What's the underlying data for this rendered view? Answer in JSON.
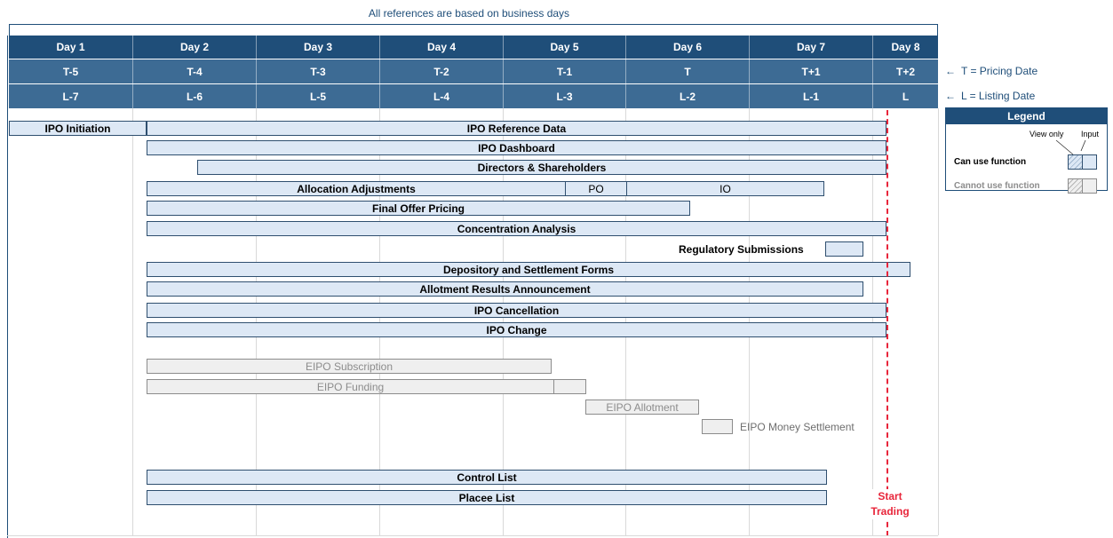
{
  "note": "All references are based on business days",
  "days": [
    "Day 1",
    "Day 2",
    "Day 3",
    "Day 4",
    "Day 5",
    "Day 6",
    "Day 7",
    "Day 8"
  ],
  "t_labels": [
    "T-5",
    "T-4",
    "T-3",
    "T-2",
    "T-1",
    "T",
    "T+1",
    "T+2"
  ],
  "l_labels": [
    "L-7",
    "L-6",
    "L-5",
    "L-4",
    "L-3",
    "L-2",
    "L-1",
    "L"
  ],
  "side_notes": {
    "t_note": "T = Pricing Date",
    "l_note": "L = Listing Date",
    "arrow": "←"
  },
  "legend": {
    "title": "Legend",
    "view_only": "View only",
    "input": "Input",
    "can": "Can use function",
    "cannot": "Cannot use function"
  },
  "bars": {
    "ipo_initiation": "IPO Initiation",
    "ipo_reference_data": "IPO Reference Data",
    "ipo_dashboard": "IPO Dashboard",
    "directors_shareholders": "Directors & Shareholders",
    "allocation_adjustments": "Allocation Adjustments",
    "po": "PO",
    "io": "IO",
    "final_offer_pricing": "Final Offer Pricing",
    "concentration_analysis": "Concentration Analysis",
    "regulatory_submissions": "Regulatory Submissions",
    "depository_settlement": "Depository and Settlement Forms",
    "allotment_results": "Allotment Results Announcement",
    "ipo_cancellation": "IPO Cancellation",
    "ipo_change": "IPO Change",
    "eipo_subscription": "EIPO Subscription",
    "eipo_funding": "EIPO Funding",
    "eipo_allotment": "EIPO Allotment",
    "eipo_money_settlement": "EIPO Money Settlement",
    "control_list": "Control List",
    "placee_list": "Placee List"
  },
  "start_trading": {
    "line1": "Start",
    "line2": "Trading"
  },
  "colors": {
    "header_dark": "#1f4e79",
    "header_mid": "#3d6b94",
    "bar_can": "#dde8f5",
    "bar_cannot": "#efefef",
    "start_trading": "#e8263b"
  }
}
